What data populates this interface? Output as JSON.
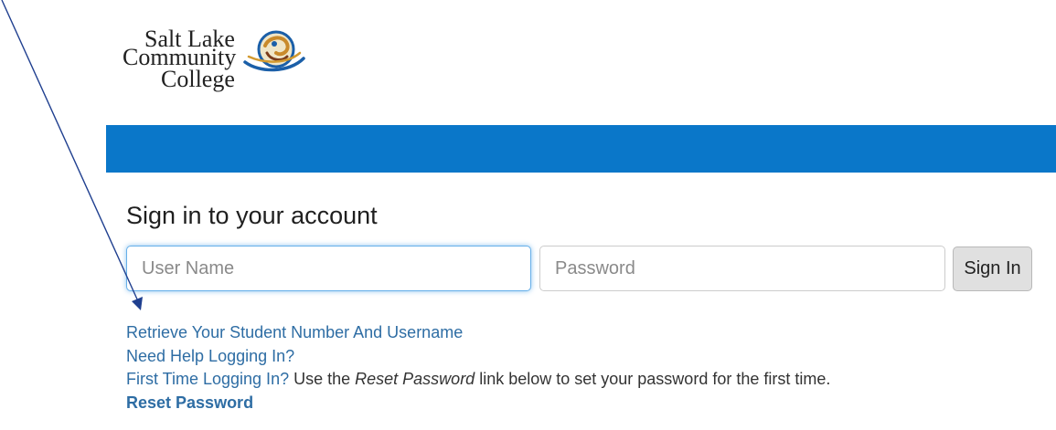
{
  "logo": {
    "line1": "Salt Lake",
    "line2": "Community",
    "line3": "College"
  },
  "page": {
    "heading": "Sign in to your account"
  },
  "form": {
    "username_placeholder": "User Name",
    "password_placeholder": "Password",
    "signin_label": "Sign In"
  },
  "links": {
    "retrieve": "Retrieve Your Student Number And Username",
    "help": "Need Help Logging In?",
    "first_time": "First Time Logging In?",
    "first_time_pre": " Use the ",
    "first_time_emph": "Reset Password",
    "first_time_post": " link below to set your password for the first time.",
    "reset": "Reset Password"
  },
  "colors": {
    "banner": "#0a77c9",
    "link": "#2e6da4",
    "annotation_line": "#1f3f8f"
  },
  "icons": {
    "logo_mark": "slcc-swirl-icon",
    "annotation": "annotation-arrow-icon"
  }
}
